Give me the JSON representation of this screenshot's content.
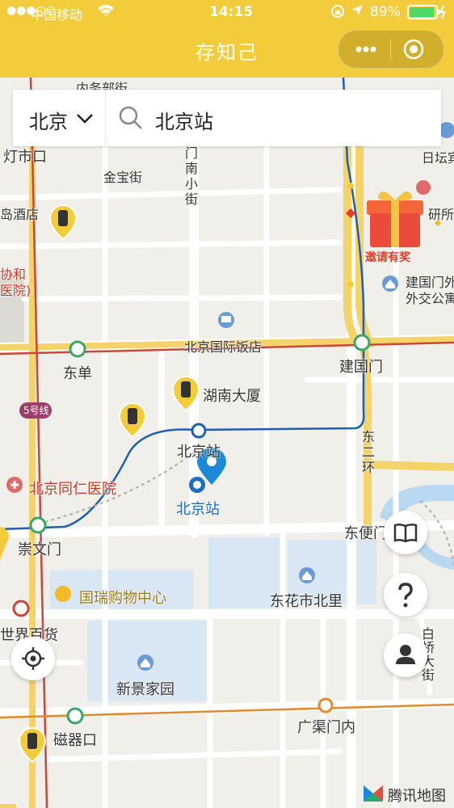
{
  "status_bar": {
    "carrier": "中国移动",
    "time": "14:15",
    "battery": "89%"
  },
  "nav": {
    "title": "存知己",
    "menu_icon": "more-dots-icon",
    "close_icon": "target-circle-icon"
  },
  "search": {
    "city": "北京",
    "query": "北京站"
  },
  "map": {
    "labels": {
      "nw_top": "内务部街",
      "lantern": "灯市口",
      "jinbao": "金宝街",
      "mennanxiaojie": "门南小街",
      "island_hotel": "岛酒店",
      "xiehe1": "协和",
      "xiehe2": "医院)",
      "ritan": "日坛宾",
      "yuansuo": "研所",
      "jianguomen_wai1": "建国门外",
      "jianguomen_wai2": "外交公寓",
      "intl_hotel": "北京国际饭店",
      "dongdan": "东单",
      "jianguomen": "建国门",
      "hunan": "湖南大厦",
      "line5": "5号线",
      "station_subway": "北京站",
      "dong_er_huan": "东二环",
      "tongren": "北京同仁医院",
      "station_main": "北京站",
      "dongbianmen": "东便门",
      "chongwenmen": "崇文门",
      "guorui": "国瑞购物中心",
      "donghuashi": "东花市北里",
      "world_store": "世界百货",
      "xinjing": "新景家园",
      "baiqiao": "白桥大街",
      "guangqumen": "广渠门内",
      "ciqikou": "磁器口",
      "beijing_zhan": "北京站"
    },
    "colors": {
      "road_red": "#c9473a",
      "road_blue": "#1f5fb3",
      "road_orange": "#e08a2c",
      "pin": "#1a8ad8",
      "locker": "#f2cc3a"
    }
  },
  "promo": {
    "label": "邀请有奖",
    "icon": "gift-icon"
  },
  "buttons": {
    "book": "book-icon",
    "help": "question-icon",
    "profile": "person-icon",
    "locate": "locate-icon"
  },
  "footer": {
    "logo_text": "腾讯地图"
  }
}
